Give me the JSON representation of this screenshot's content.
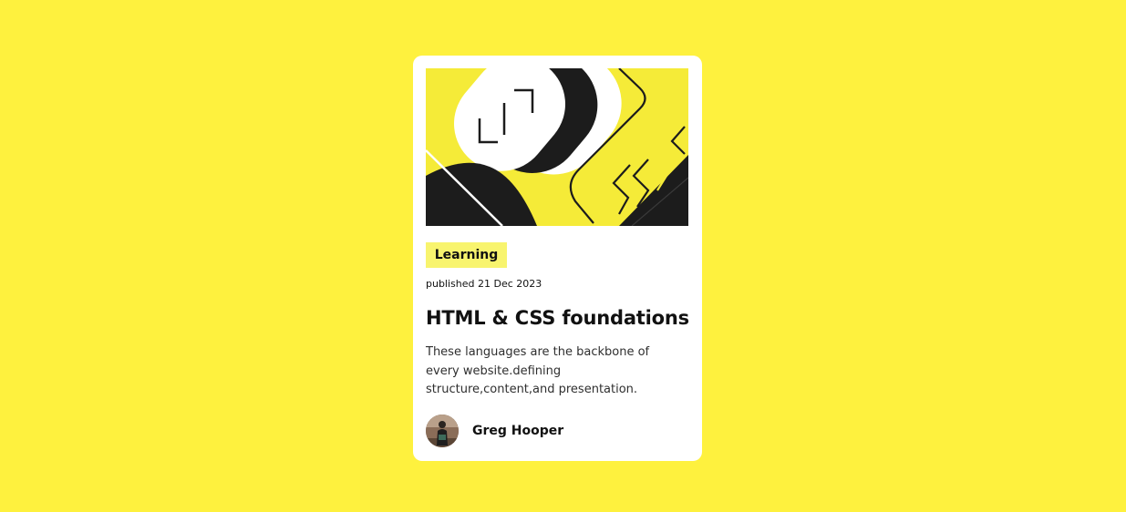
{
  "card": {
    "tag": "Learning",
    "published": "published 21 Dec 2023",
    "title": "HTML & CSS foundations",
    "description": "These languages are the backbone of every website.defining structure,content,and presentation.",
    "author": {
      "name": "Greg Hooper",
      "avatar_icon": "person-photo-avatar"
    },
    "hero_icon": "code-illustration"
  },
  "colors": {
    "background": "#FEF13E",
    "card": "#FFFFFF",
    "tag_background": "#F8F46E",
    "text": "#111111",
    "illustration_dark": "#1C1C1C"
  }
}
